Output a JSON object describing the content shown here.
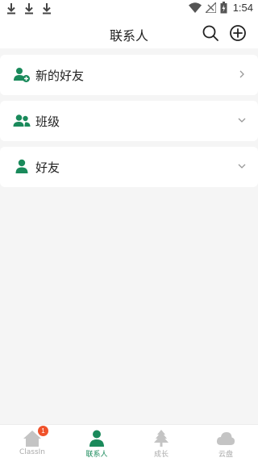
{
  "status_bar": {
    "time": "1:54",
    "download_icon": "download-icon",
    "wifi_icon": "wifi-icon",
    "signal_icon": "no-signal-icon",
    "battery_icon": "battery-charging-icon"
  },
  "header": {
    "title": "联系人",
    "search_icon": "search-icon",
    "add_icon": "add-circle-icon"
  },
  "contacts": {
    "new_friends": {
      "label": "新的好友",
      "icon": "add-user-icon"
    },
    "classes": {
      "label": "班级",
      "icon": "group-icon"
    },
    "friends": {
      "label": "好友",
      "icon": "person-icon"
    }
  },
  "bottom_nav": {
    "items": [
      {
        "label": "ClassIn",
        "icon": "home-icon",
        "badge": "1"
      },
      {
        "label": "联系人",
        "icon": "person-icon",
        "active": true
      },
      {
        "label": "成长",
        "icon": "tree-icon"
      },
      {
        "label": "云盘",
        "icon": "cloud-icon"
      }
    ]
  },
  "colors": {
    "accent": "#1a8a5b",
    "badge": "#f0522b",
    "background": "#f5f5f5",
    "inactive": "#aaaaaa"
  }
}
